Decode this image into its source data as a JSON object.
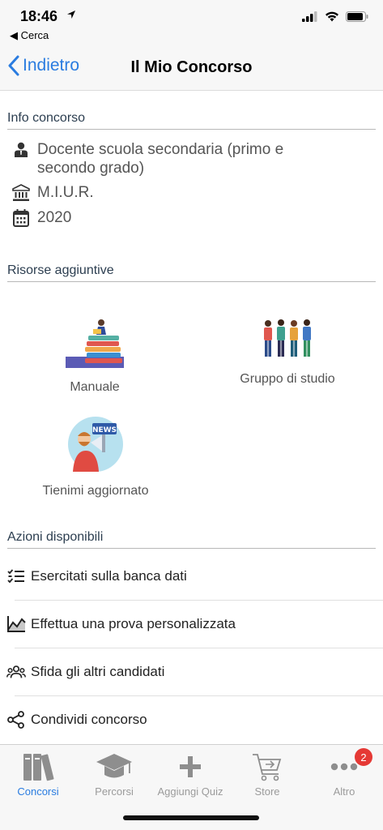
{
  "status_bar": {
    "time": "18:46",
    "back_app": "◀ Cerca"
  },
  "nav": {
    "back_label": "Indietro",
    "title": "Il Mio Concorso",
    "accent_color": "#2a7ce0"
  },
  "info": {
    "section_title": "Info concorso",
    "rows": [
      {
        "icon": "person-icon",
        "text": "Docente scuola secondaria (primo e secondo grado)"
      },
      {
        "icon": "institution-icon",
        "text": "M.I.U.R."
      },
      {
        "icon": "calendar-icon",
        "text": "2020"
      }
    ]
  },
  "resources": {
    "section_title": "Risorse aggiuntive",
    "items": [
      {
        "label": "Manuale",
        "icon": "books-reader-illustration"
      },
      {
        "label": "Gruppo di studio",
        "icon": "study-group-illustration"
      },
      {
        "label": "Tienimi aggiornato",
        "icon": "news-megaphone-illustration"
      }
    ]
  },
  "actions": {
    "section_title": "Azioni disponibili",
    "items": [
      {
        "label": "Esercitati sulla banca dati",
        "icon": "checklist-icon"
      },
      {
        "label": "Effettua una prova personalizzata",
        "icon": "chart-icon"
      },
      {
        "label": "Sfida gli altri candidati",
        "icon": "group-icon"
      },
      {
        "label": "Condividi concorso",
        "icon": "share-icon"
      }
    ]
  },
  "tabs": [
    {
      "label": "Concorsi",
      "icon": "books-icon",
      "active": true
    },
    {
      "label": "Percorsi",
      "icon": "graduation-cap-icon",
      "active": false
    },
    {
      "label": "Aggiungi Quiz",
      "icon": "plus-icon",
      "active": false
    },
    {
      "label": "Store",
      "icon": "cart-icon",
      "active": false
    },
    {
      "label": "Altro",
      "icon": "more-icon",
      "active": false,
      "badge": "2"
    }
  ]
}
